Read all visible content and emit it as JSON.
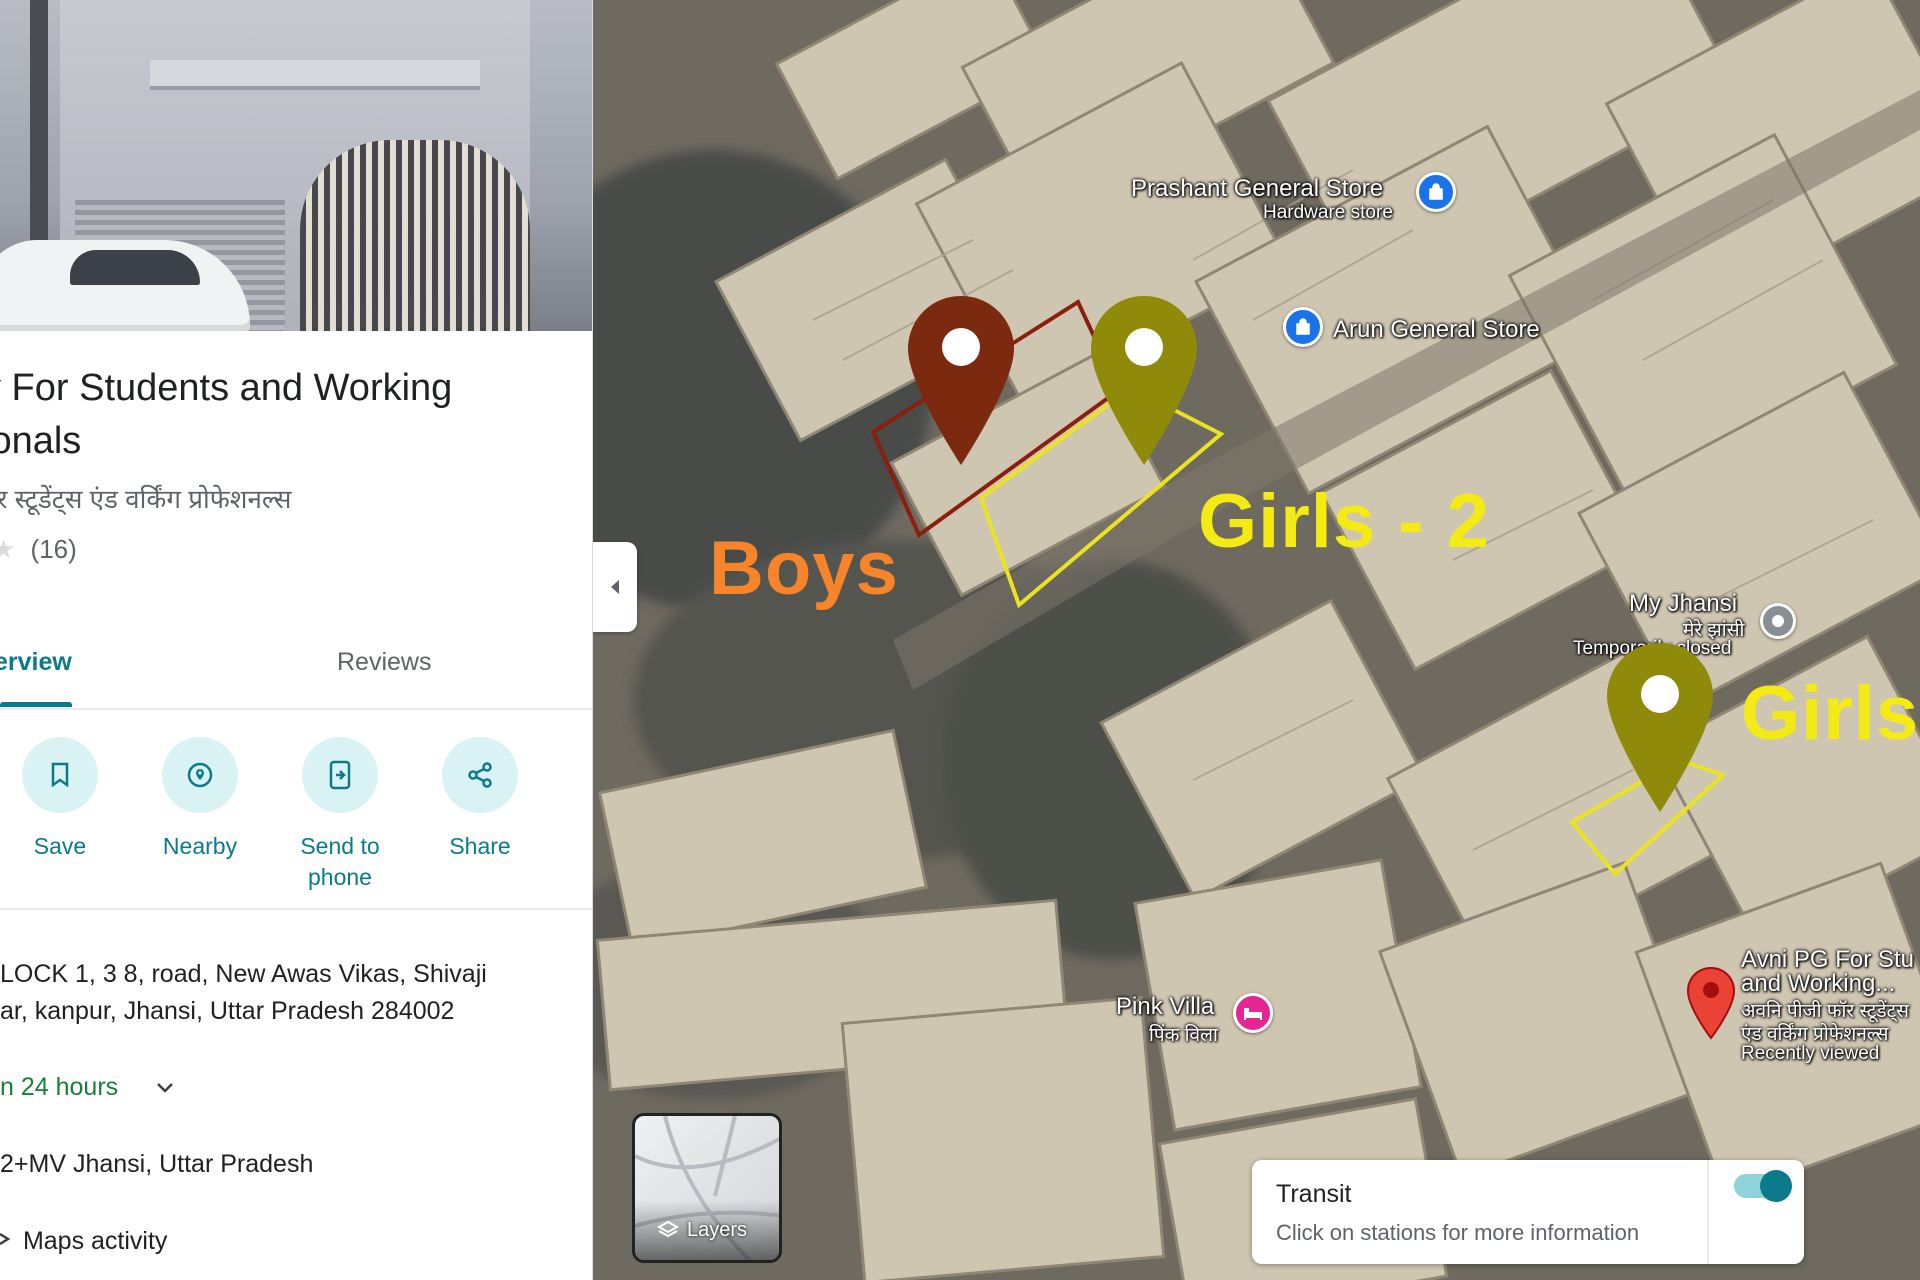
{
  "place": {
    "title_line1": "y For Students and Working",
    "title_line2": "ionals",
    "subtitle": "फॉर स्टूडेंट्स एंड वर्किंग प्रोफेशनल्स",
    "rating_count": "(16)"
  },
  "tabs": [
    {
      "label": "erview"
    },
    {
      "label": "Reviews"
    }
  ],
  "actions": [
    {
      "label": "Save",
      "icon": "bookmark-icon"
    },
    {
      "label": "Nearby",
      "icon": "nearby-icon"
    },
    {
      "label": "Send to",
      "label2": "phone",
      "icon": "send-to-phone-icon"
    },
    {
      "label": "Share",
      "icon": "share-icon"
    }
  ],
  "info": {
    "address_line1": "LOCK 1, 3 8, road, New Awas Vikas, Shivaji",
    "address_line2": "ar, kanpur, Jhansi, Uttar Pradesh 284002",
    "hours": "n 24 hours",
    "plus_code": "2+MV Jhansi, Uttar Pradesh",
    "activity": "Maps activity"
  },
  "map": {
    "labels": {
      "prashant": "Prashant General Store",
      "prashant_sub": "Hardware store",
      "arun": "Arun General Store",
      "myjhansi": "My Jhansi",
      "myjhansi_hi": "मेरे झांसी",
      "myjhansi_status": "Temporarily closed",
      "pinkvilla": "Pink Villa",
      "pinkvilla_hi": "पिंक विला",
      "avni1": "Avni PG For Stu",
      "avni2": "and Working...",
      "avni3": "अवनि पीजी फॉर स्टूडेंट्स",
      "avni4": "एंड वर्किंग प्रोफेशनल्स",
      "avni5": "Recently viewed"
    },
    "annotations": {
      "boys": "Boys",
      "girls2": "Girls - 2",
      "girls": "Girls"
    },
    "colors": {
      "boys": "#f5842a",
      "girls": "#f4ea14",
      "boys_pin": "#7b2a10",
      "girls_pin": "#8f8a0a"
    }
  },
  "layers": {
    "label": "Layers"
  },
  "transit": {
    "title": "Transit",
    "subtitle": "Click on stations for more information",
    "enabled": true
  }
}
